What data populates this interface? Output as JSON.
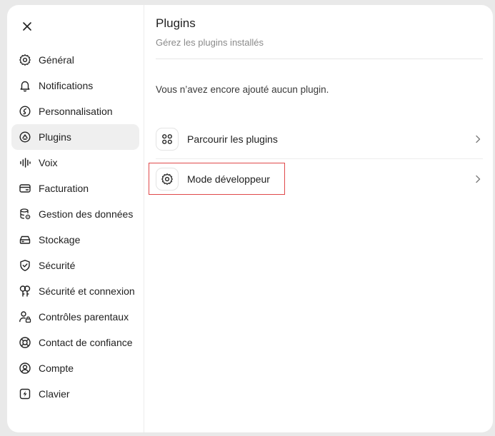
{
  "sidebar": {
    "close_icon": "close-icon",
    "items": [
      {
        "label": "Général",
        "icon": "gear-icon"
      },
      {
        "label": "Notifications",
        "icon": "bell-icon"
      },
      {
        "label": "Personnalisation",
        "icon": "personalization-icon"
      },
      {
        "label": "Plugins",
        "icon": "plugin-icon",
        "active": true
      },
      {
        "label": "Voix",
        "icon": "voice-wave-icon"
      },
      {
        "label": "Facturation",
        "icon": "card-icon"
      },
      {
        "label": "Gestion des données",
        "icon": "database-icon"
      },
      {
        "label": "Stockage",
        "icon": "storage-icon"
      },
      {
        "label": "Sécurité",
        "icon": "shield-icon"
      },
      {
        "label": "Sécurité et connexion",
        "icon": "key-icon"
      },
      {
        "label": "Contrôles parentaux",
        "icon": "parental-lock-icon"
      },
      {
        "label": "Contact de confiance",
        "icon": "lifebuoy-icon"
      },
      {
        "label": "Compte",
        "icon": "account-icon"
      },
      {
        "label": "Clavier",
        "icon": "keyboard-bolt-icon"
      }
    ]
  },
  "main": {
    "title": "Plugins",
    "subtitle": "Gérez les plugins installés",
    "empty_message": "Vous n’avez encore ajouté aucun plugin.",
    "rows": [
      {
        "label": "Parcourir les plugins",
        "icon": "grid-icon"
      },
      {
        "label": "Mode développeur",
        "icon": "gear-icon",
        "highlighted": true
      }
    ]
  },
  "colors": {
    "highlight_border": "#e0494b",
    "active_item_bg": "#efefef"
  }
}
